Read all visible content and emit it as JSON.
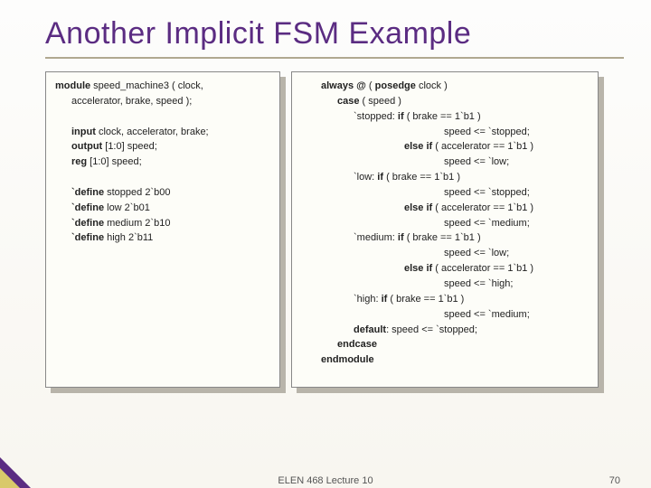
{
  "title": "Another Implicit FSM Example",
  "left": {
    "l1a": "module",
    "l1b": " speed_machine3 ( clock,",
    "l2": "accelerator, brake, speed );",
    "l3a": "input",
    "l3b": " clock, accelerator, brake;",
    "l4a": "output",
    "l4b": " [1:0] speed;",
    "l5a": "reg",
    "l5b": " [1:0] speed;",
    "l6a": "`define",
    "l6b": " stopped 2`b00",
    "l7a": "`define",
    "l7b": " low 2`b01",
    "l8a": "`define",
    "l8b": " medium 2`b10",
    "l9a": "`define",
    "l9b": " high 2`b11"
  },
  "right": {
    "r1a": "always @",
    "r1b": " ( ",
    "r1c": "posedge",
    "r1d": " clock )",
    "r2a": "case",
    "r2b": " ( speed )",
    "r3a": "`stopped: ",
    "r3b": "if",
    "r3c": " ( brake == 1`b1 )",
    "r4": "speed <= `stopped;",
    "r5a": "else if",
    "r5b": " ( accelerator == 1`b1 )",
    "r6": "speed <= `low;",
    "r7a": "`low: ",
    "r7b": "if",
    "r7c": " ( brake == 1`b1 )",
    "r8": "speed <= `stopped;",
    "r9a": "else if",
    "r9b": " ( accelerator == 1`b1 )",
    "r10": "speed <= `medium;",
    "r11a": "`medium: ",
    "r11b": "if",
    "r11c": " ( brake == 1`b1 )",
    "r12": "speed <= `low;",
    "r13a": "else if",
    "r13b": " ( accelerator == 1`b1 )",
    "r14": "speed <= `high;",
    "r15a": "`high: ",
    "r15b": "if",
    "r15c": " ( brake == 1`b1 )",
    "r16": "speed <= `medium;",
    "r17a": "default",
    "r17b": ": speed <= `stopped;",
    "r18": "endcase",
    "r19": "endmodule"
  },
  "footer": {
    "center": "ELEN 468 Lecture 10",
    "right": "70"
  }
}
